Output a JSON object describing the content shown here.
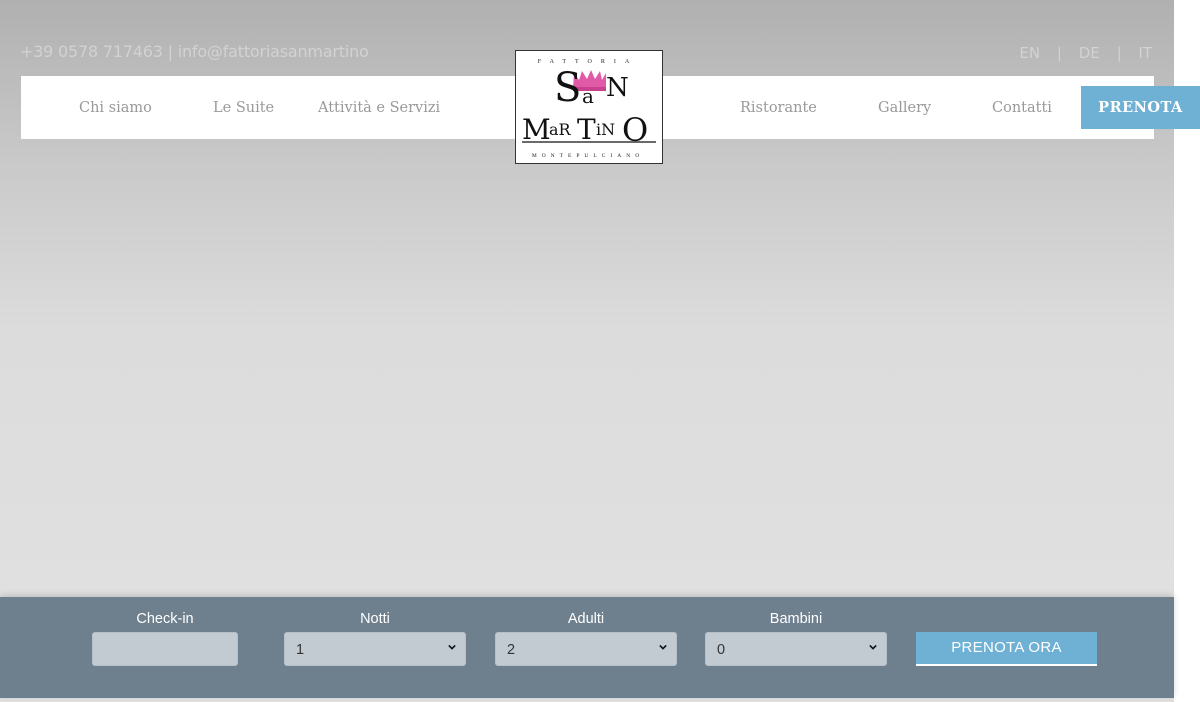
{
  "topbar": {
    "contact": "+39 0578 717463 | info@fattoriasanmartino",
    "languages": [
      "EN",
      "|",
      "DE",
      "|",
      "IT"
    ]
  },
  "nav": {
    "left": [
      "Chi siamo",
      "Le Suite",
      "Attività e Servizi"
    ],
    "right": [
      "Ristorante",
      "Gallery",
      "Contatti"
    ],
    "cta": "PRENOTA"
  },
  "logo": {
    "top": "FATTORIA",
    "line1": "San",
    "line2": "MarTiNO",
    "bottom": "MONTEPULCIANO",
    "crown_icon": "crown-icon",
    "crown_color": "#e05aa8"
  },
  "booking": {
    "checkin_label": "Check-in",
    "notti_label": "Notti",
    "adulti_label": "Adulti",
    "bambini_label": "Bambini",
    "notti_value": "1",
    "adulti_value": "2",
    "bambini_value": "0",
    "submit": "PRENOTA ORA"
  }
}
